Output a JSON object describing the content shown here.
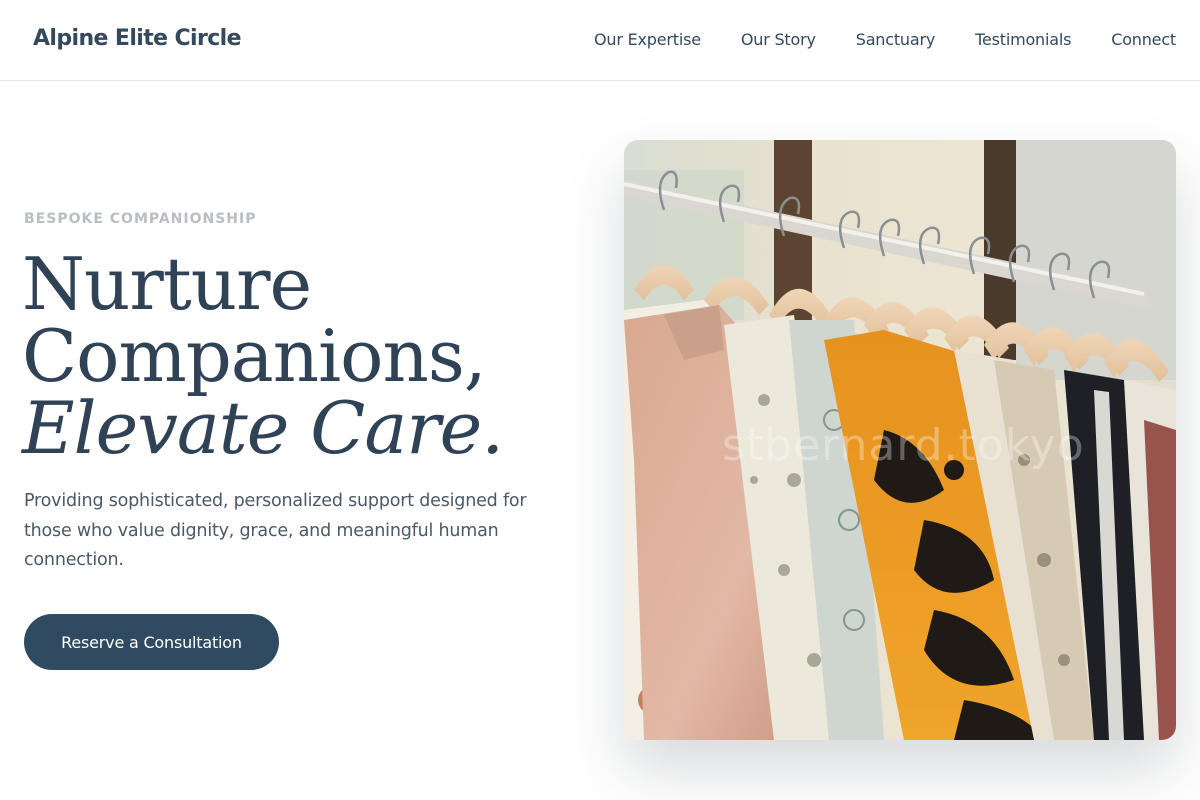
{
  "header": {
    "brand": "Alpine Elite Circle",
    "nav": [
      "Our Expertise",
      "Our Story",
      "Sanctuary",
      "Testimonials",
      "Connect"
    ]
  },
  "hero": {
    "eyebrow": "BESPOKE COMPANIONSHIP",
    "headline_line1": "Nurture",
    "headline_line2": "Companions,",
    "headline_line3": "Elevate Care.",
    "description": "Providing sophisticated, personalized support designed for those who value dignity, grace, and meaningful human connection.",
    "cta_label": "Reserve a Consultation"
  },
  "photo": {
    "subject": "clothing-rack-image",
    "watermark": "stbernard.tokyo"
  },
  "colors": {
    "primary": "#2f4a61",
    "text": "#34495e",
    "muted": "#b9bec4",
    "divider": "#e6e8ea"
  }
}
